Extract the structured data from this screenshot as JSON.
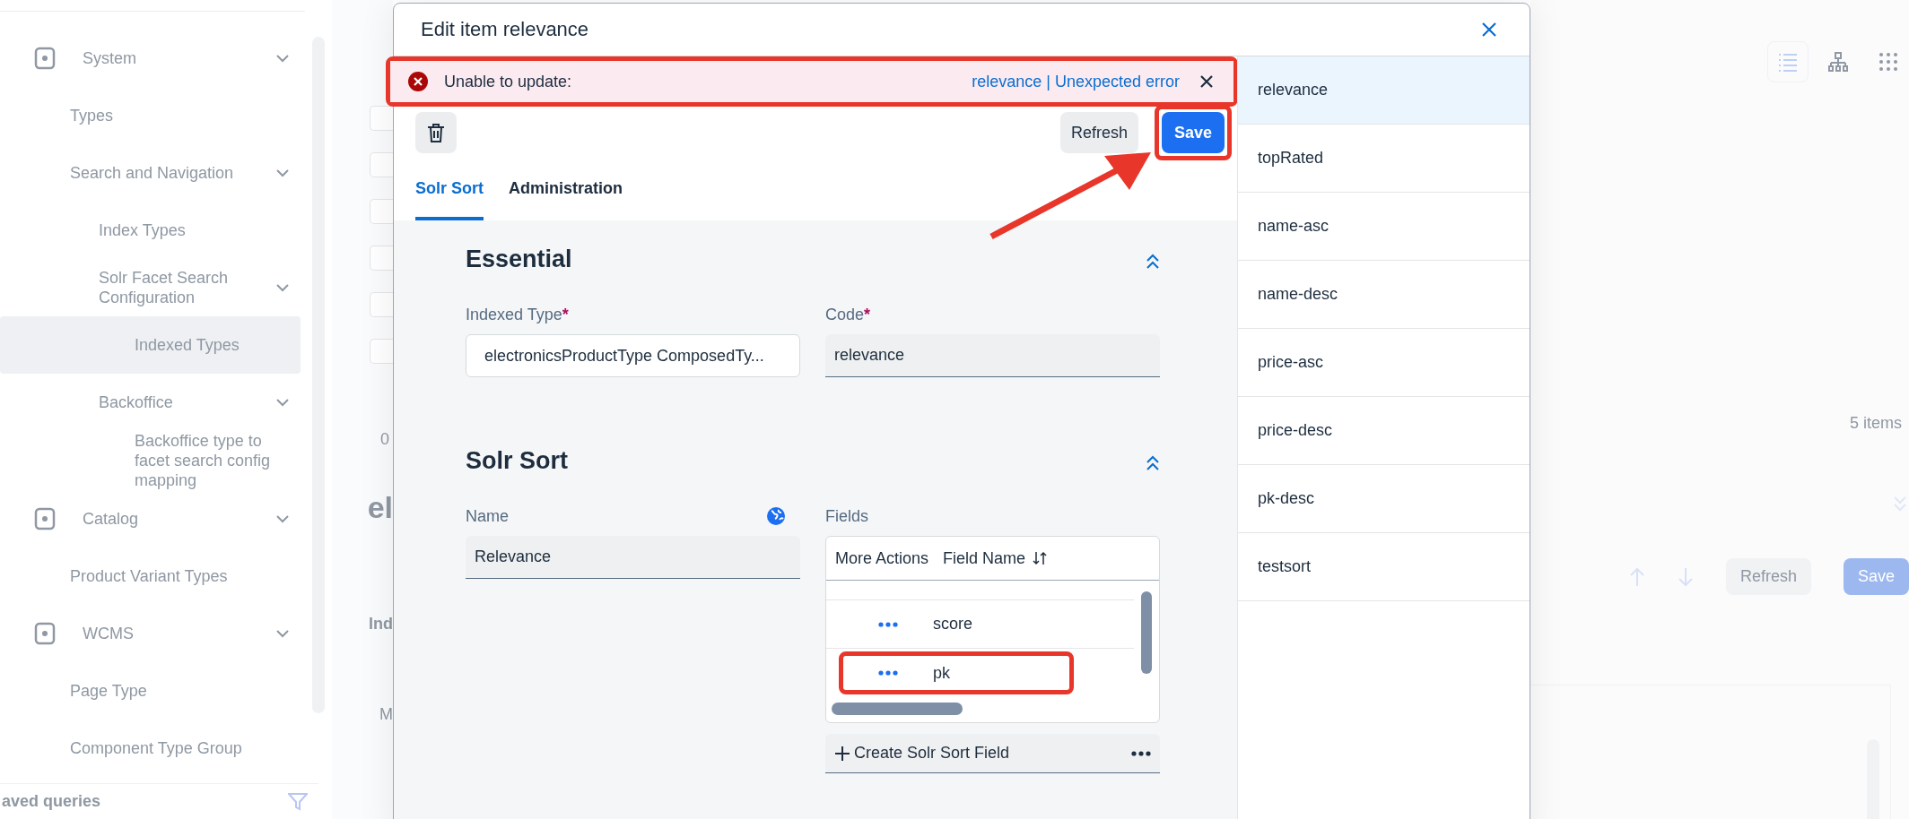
{
  "sidebar": {
    "items": [
      {
        "label": "System",
        "kind": "category",
        "expandable": true,
        "selected": false
      },
      {
        "label": "Types",
        "kind": "link",
        "expandable": false,
        "selected": false
      },
      {
        "label": "Search and Navigation",
        "kind": "link",
        "expandable": true,
        "selected": false,
        "children": [
          {
            "label": "Index Types",
            "kind": "link",
            "expandable": false,
            "selected": false
          },
          {
            "label": "Solr Facet Search Configuration",
            "kind": "link",
            "expandable": true,
            "selected": false,
            "children": [
              {
                "label": "Indexed Types",
                "kind": "link",
                "expandable": false,
                "selected": true
              }
            ]
          },
          {
            "label": "Backoffice",
            "kind": "link",
            "expandable": true,
            "selected": false,
            "children": [
              {
                "label": "Backoffice type to facet search config mapping",
                "kind": "link",
                "expandable": false,
                "selected": false
              }
            ]
          }
        ]
      },
      {
        "label": "Catalog",
        "kind": "category",
        "expandable": true,
        "selected": false
      },
      {
        "label": "Product Variant Types",
        "kind": "link",
        "expandable": false,
        "selected": false
      },
      {
        "label": "WCMS",
        "kind": "category",
        "expandable": true,
        "selected": false
      },
      {
        "label": "Page Type",
        "kind": "link",
        "expandable": false,
        "selected": false
      },
      {
        "label": "Component Type Group",
        "kind": "link",
        "expandable": false,
        "selected": false
      }
    ],
    "saved_queries": "aved queries"
  },
  "background": {
    "checkboxes": [
      {
        "checked": false
      },
      {
        "checked": false
      },
      {
        "checked": false
      },
      {
        "checked": false
      },
      {
        "checked": false
      },
      {
        "checked": false
      }
    ],
    "page_number": "0",
    "heading": "el",
    "section_label": "Ind",
    "column_label": "M",
    "view_modes": [
      {
        "selected": true
      },
      {
        "selected": false
      },
      {
        "selected": false
      }
    ],
    "item_count": "5 items",
    "buttons": [
      "Refresh",
      "Save"
    ]
  },
  "modal": {
    "title": "Edit item relevance",
    "error": {
      "message": "Unable to update:",
      "link": "relevance | Unexpected error",
      "annotated": true
    },
    "refresh": "Refresh",
    "save": {
      "label": "Save",
      "annotated": true
    },
    "tabs": [
      {
        "label": "Solr Sort",
        "selected": true
      },
      {
        "label": "Administration",
        "selected": false
      }
    ],
    "sections": [
      {
        "title": "Essential",
        "expanded": true,
        "fields": [
          {
            "kind": "reference",
            "label": "Indexed Type",
            "required_mark": "*",
            "localized": false,
            "value": "electronicsProductType ComposedTy..."
          },
          {
            "kind": "text",
            "label": "Code",
            "required_mark": "*",
            "localized": false,
            "value": "relevance"
          }
        ]
      },
      {
        "title": "Solr Sort",
        "expanded": true,
        "fields": [
          {
            "kind": "text",
            "label": "Name",
            "localized": true,
            "value": "Relevance"
          },
          {
            "kind": "table",
            "label": "Fields",
            "localized": false,
            "columns": [
              "More Actions",
              "Field Name"
            ],
            "rows": [
              {
                "value": "score",
                "annotated": false
              },
              {
                "value": "pk",
                "annotated": true
              }
            ],
            "create_button": "Create Solr Sort Field"
          }
        ]
      }
    ],
    "list": [
      {
        "label": "relevance",
        "selected": true
      },
      {
        "label": "topRated",
        "selected": false
      },
      {
        "label": "name-asc",
        "selected": false
      },
      {
        "label": "name-desc",
        "selected": false
      },
      {
        "label": "price-asc",
        "selected": false
      },
      {
        "label": "price-desc",
        "selected": false
      },
      {
        "label": "pk-desc",
        "selected": false
      },
      {
        "label": "testsort",
        "selected": false
      }
    ],
    "arrow": true
  }
}
